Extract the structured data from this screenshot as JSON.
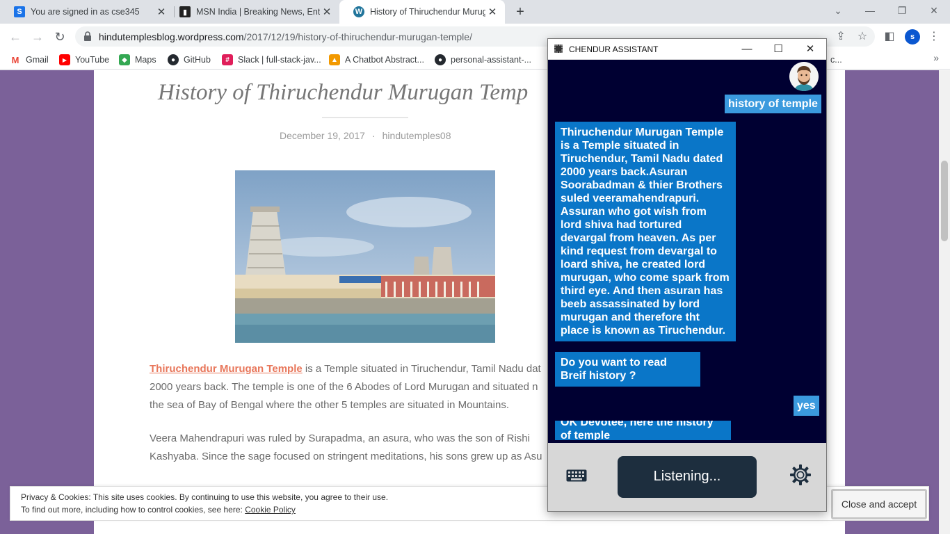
{
  "browser": {
    "tabs": [
      {
        "title": "You are signed in as cse345",
        "icon": "s-square-icon"
      },
      {
        "title": "MSN India | Breaking News, Ente",
        "icon": "msn-icon"
      },
      {
        "title": "History of Thiruchendur Muruga",
        "icon": "wordpress-icon",
        "active": true
      }
    ],
    "url_host": "hindutemplesblog.wordpress.com",
    "url_path": "/2017/12/19/history-of-thiruchendur-murugan-temple/",
    "bookmarks": [
      {
        "label": "Gmail",
        "icon": "gmail-icon",
        "color": "#ea4335"
      },
      {
        "label": "YouTube",
        "icon": "youtube-icon",
        "color": "#ff0000"
      },
      {
        "label": "Maps",
        "icon": "maps-icon",
        "color": "#34a853"
      },
      {
        "label": "GitHub",
        "icon": "github-icon",
        "color": "#24292f"
      },
      {
        "label": "Slack | full-stack-jav...",
        "icon": "slack-icon",
        "color": "#4a154b"
      },
      {
        "label": "A Chatbot Abstract...",
        "icon": "chatbot-abstract-icon",
        "color": "#f29900"
      },
      {
        "label": "personal-assistant-...",
        "icon": "github-icon",
        "color": "#24292f"
      }
    ],
    "bookmarks_partial": "c...",
    "profile_initial": "s"
  },
  "page": {
    "title": "History of Thiruchendur Murugan Temp",
    "date": "December 19, 2017",
    "separator": "·",
    "author": "hindutemples08",
    "para1_link": "Thiruchendur Murugan Temple",
    "para1_rest": " is a Temple situated in Tiruchendur, Tamil Nadu dat",
    "para1_line2": "2000 years back. The temple is one of the 6 Abodes of Lord Murugan and situated n",
    "para1_line3": "the sea of Bay of Bengal where the other 5 temples are situated in Mountains.",
    "para2_line1": "Veera Mahendrapuri was ruled by Surapadma, an asura, who was the son of Rishi",
    "para2_line2": "Kashyaba. Since the sage focused on stringent meditations, his sons grew up as Asu"
  },
  "cookie": {
    "line1": "Privacy & Cookies: This site uses cookies. By continuing to use this website, you agree to their use.",
    "line2_prefix": "To find out more, including how to control cookies, see here: ",
    "line2_link": "Cookie Policy",
    "accept_label": "Close and accept"
  },
  "assistant": {
    "window_title": "CHENDUR ASSISTANT",
    "messages": [
      {
        "from": "user",
        "text": "history of temple"
      },
      {
        "from": "bot",
        "text": "Thiruchendur Murugan Temple is a Temple situated in Tiruchendur, Tamil Nadu dated 2000 years back.Asuran Soorabadman & thier Brothers suled veeramahendrapuri. Assuran who got wish from lord shiva had tortured devargal from heaven. As per kind request from devargal to loard shiva, he created lord murugan, who come spark from third eye. And then asuran has beeb assassinated by lord murugan and therefore tht place is known as Tiruchendur."
      },
      {
        "from": "bot",
        "text": "Do you want to read Breif history ?"
      },
      {
        "from": "user",
        "text": "yes"
      },
      {
        "from": "bot",
        "text": "OK Devotee, here the history of temple"
      }
    ],
    "listening_label": "Listening...",
    "colors": {
      "background": "#000032",
      "bot_bubble": "#0a76c8",
      "user_bubble": "#3b9ade",
      "footer": "#d7d7d7",
      "listen_button": "#1d2e3e"
    }
  }
}
